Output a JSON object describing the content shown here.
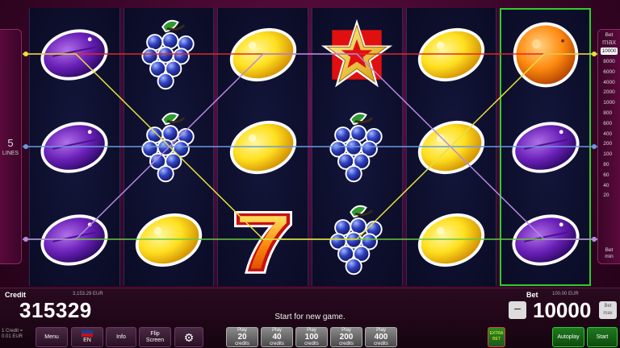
{
  "lines": {
    "count": "5",
    "label": "LINES"
  },
  "bet_panel": {
    "head_top": "Bet",
    "head_bottom": "max",
    "selected": "10000",
    "levels": [
      "8000",
      "6000",
      "4000",
      "2000",
      "1000",
      "800",
      "600",
      "400",
      "200",
      "100",
      "80",
      "60",
      "40",
      "20"
    ],
    "foot_top": "Bet",
    "foot_bottom": "min"
  },
  "reels": [
    [
      "plum",
      "plum",
      "plum"
    ],
    [
      "grapes",
      "grapes",
      "lemon"
    ],
    [
      "lemon",
      "lemon",
      "seven"
    ],
    [
      "star",
      "grapes",
      "grapes"
    ],
    [
      "lemon",
      "lemon",
      "lemon"
    ],
    [
      "orange",
      "plum",
      "plum"
    ]
  ],
  "winning_reel": 5,
  "payline_colors": [
    "#e6e040",
    "#e02828",
    "#6a9ae0",
    "#6ac83a",
    "#b48ae0"
  ],
  "credit": {
    "label": "Credit",
    "eur": "3,153.29 EUR",
    "value": "315329"
  },
  "bet": {
    "label": "Bet",
    "eur": "100.00 EUR",
    "value": "10000",
    "minus": "−",
    "max": "max"
  },
  "message": "Start for new game.",
  "denom": {
    "line1": "1 Credit =",
    "line2": "0.01 EUR"
  },
  "buttons": {
    "menu": "Menu",
    "language": "EN",
    "info": "Info",
    "flip_line1": "Flip",
    "flip_line2": "Screen",
    "autoplay": "Autoplay",
    "start": "Start",
    "gamble": "EXTRA BET"
  },
  "play_buttons": [
    {
      "top": "Play",
      "num": "20",
      "bottom": "credits"
    },
    {
      "top": "Play",
      "num": "40",
      "bottom": "credits"
    },
    {
      "top": "Play",
      "num": "100",
      "bottom": "credits"
    },
    {
      "top": "Play",
      "num": "200",
      "bottom": "credits"
    },
    {
      "top": "Play",
      "num": "400",
      "bottom": "credits"
    }
  ]
}
